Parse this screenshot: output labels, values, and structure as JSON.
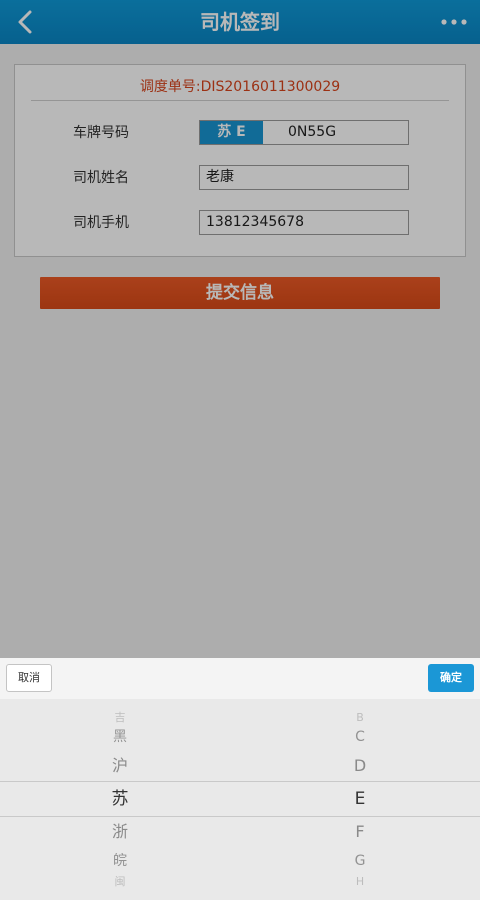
{
  "header": {
    "title": "司机签到"
  },
  "form": {
    "order_label": "调度单号:",
    "order_no": "DIS2016011300029",
    "plate": {
      "label": "车牌号码",
      "prefix": "苏 E",
      "number": "0N55G"
    },
    "name": {
      "label": "司机姓名",
      "value": "老康"
    },
    "phone": {
      "label": "司机手机",
      "value": "13812345678"
    },
    "submit_label": "提交信息"
  },
  "picker": {
    "cancel_label": "取消",
    "confirm_label": "确定",
    "province_items": [
      "吉",
      "黑",
      "沪",
      "苏",
      "浙",
      "皖",
      "闽"
    ],
    "letter_items": [
      "B",
      "C",
      "D",
      "E",
      "F",
      "G",
      "H"
    ],
    "selected_index": 3
  },
  "colors": {
    "header": "#0a86c5",
    "accent": "#d9441c",
    "prefix": "#1895d2"
  }
}
